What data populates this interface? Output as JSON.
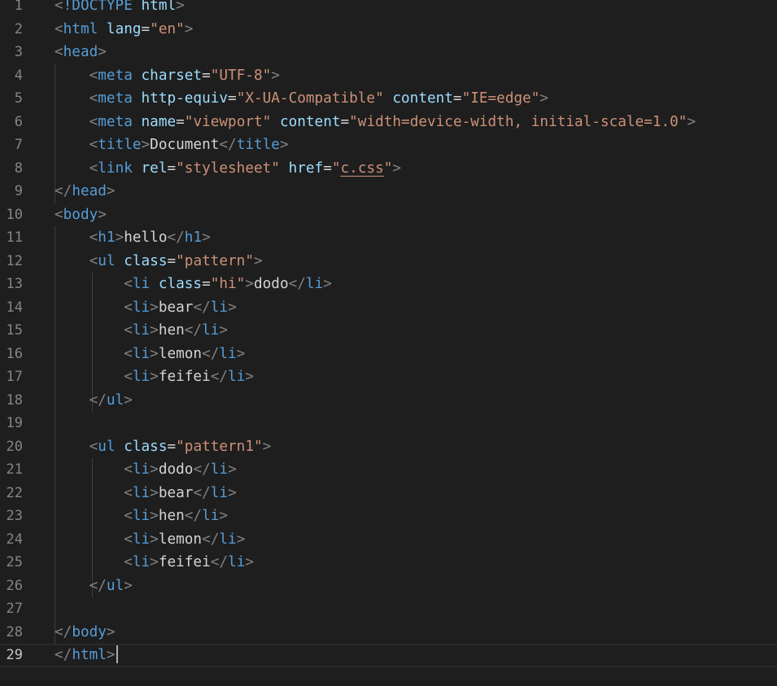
{
  "editor": {
    "active_line": 29,
    "lines": [
      {
        "n": "1",
        "tokens": [
          {
            "t": "<",
            "c": "p"
          },
          {
            "t": "!DOCTYPE",
            "c": "t"
          },
          {
            "t": " ",
            "c": "x"
          },
          {
            "t": "html",
            "c": "a"
          },
          {
            "t": ">",
            "c": "p"
          }
        ]
      },
      {
        "n": "2",
        "tokens": [
          {
            "t": "<",
            "c": "p"
          },
          {
            "t": "html",
            "c": "t"
          },
          {
            "t": " ",
            "c": "x"
          },
          {
            "t": "lang",
            "c": "a"
          },
          {
            "t": "=",
            "c": "x"
          },
          {
            "t": "\"en\"",
            "c": "s"
          },
          {
            "t": ">",
            "c": "p"
          }
        ]
      },
      {
        "n": "3",
        "tokens": [
          {
            "t": "<",
            "c": "p"
          },
          {
            "t": "head",
            "c": "t"
          },
          {
            "t": ">",
            "c": "p"
          }
        ]
      },
      {
        "n": "4",
        "tokens": [
          {
            "t": "    ",
            "c": "x"
          },
          {
            "t": "<",
            "c": "p"
          },
          {
            "t": "meta",
            "c": "t"
          },
          {
            "t": " ",
            "c": "x"
          },
          {
            "t": "charset",
            "c": "a"
          },
          {
            "t": "=",
            "c": "x"
          },
          {
            "t": "\"UTF-8\"",
            "c": "s"
          },
          {
            "t": ">",
            "c": "p"
          }
        ]
      },
      {
        "n": "5",
        "tokens": [
          {
            "t": "    ",
            "c": "x"
          },
          {
            "t": "<",
            "c": "p"
          },
          {
            "t": "meta",
            "c": "t"
          },
          {
            "t": " ",
            "c": "x"
          },
          {
            "t": "http-equiv",
            "c": "a"
          },
          {
            "t": "=",
            "c": "x"
          },
          {
            "t": "\"X-UA-Compatible\"",
            "c": "s"
          },
          {
            "t": " ",
            "c": "x"
          },
          {
            "t": "content",
            "c": "a"
          },
          {
            "t": "=",
            "c": "x"
          },
          {
            "t": "\"IE=edge\"",
            "c": "s"
          },
          {
            "t": ">",
            "c": "p"
          }
        ]
      },
      {
        "n": "6",
        "tokens": [
          {
            "t": "    ",
            "c": "x"
          },
          {
            "t": "<",
            "c": "p"
          },
          {
            "t": "meta",
            "c": "t"
          },
          {
            "t": " ",
            "c": "x"
          },
          {
            "t": "name",
            "c": "a"
          },
          {
            "t": "=",
            "c": "x"
          },
          {
            "t": "\"viewport\"",
            "c": "s"
          },
          {
            "t": " ",
            "c": "x"
          },
          {
            "t": "content",
            "c": "a"
          },
          {
            "t": "=",
            "c": "x"
          },
          {
            "t": "\"width=device-width, initial-scale=1.0\"",
            "c": "s"
          },
          {
            "t": ">",
            "c": "p"
          }
        ]
      },
      {
        "n": "7",
        "tokens": [
          {
            "t": "    ",
            "c": "x"
          },
          {
            "t": "<",
            "c": "p"
          },
          {
            "t": "title",
            "c": "t"
          },
          {
            "t": ">",
            "c": "p"
          },
          {
            "t": "Document",
            "c": "x"
          },
          {
            "t": "</",
            "c": "p"
          },
          {
            "t": "title",
            "c": "t"
          },
          {
            "t": ">",
            "c": "p"
          }
        ]
      },
      {
        "n": "8",
        "tokens": [
          {
            "t": "    ",
            "c": "x"
          },
          {
            "t": "<",
            "c": "p"
          },
          {
            "t": "link",
            "c": "t"
          },
          {
            "t": " ",
            "c": "x"
          },
          {
            "t": "rel",
            "c": "a"
          },
          {
            "t": "=",
            "c": "x"
          },
          {
            "t": "\"stylesheet\"",
            "c": "s"
          },
          {
            "t": " ",
            "c": "x"
          },
          {
            "t": "href",
            "c": "a"
          },
          {
            "t": "=",
            "c": "x"
          },
          {
            "t": "\"",
            "c": "s"
          },
          {
            "t": "c.css",
            "c": "s",
            "u": true
          },
          {
            "t": "\"",
            "c": "s"
          },
          {
            "t": ">",
            "c": "p"
          }
        ]
      },
      {
        "n": "9",
        "tokens": [
          {
            "t": "</",
            "c": "p"
          },
          {
            "t": "head",
            "c": "t"
          },
          {
            "t": ">",
            "c": "p"
          }
        ]
      },
      {
        "n": "10",
        "tokens": [
          {
            "t": "<",
            "c": "p"
          },
          {
            "t": "body",
            "c": "t"
          },
          {
            "t": ">",
            "c": "p"
          }
        ]
      },
      {
        "n": "11",
        "tokens": [
          {
            "t": "    ",
            "c": "x"
          },
          {
            "t": "<",
            "c": "p"
          },
          {
            "t": "h1",
            "c": "t"
          },
          {
            "t": ">",
            "c": "p"
          },
          {
            "t": "hello",
            "c": "x"
          },
          {
            "t": "</",
            "c": "p"
          },
          {
            "t": "h1",
            "c": "t"
          },
          {
            "t": ">",
            "c": "p"
          }
        ]
      },
      {
        "n": "12",
        "tokens": [
          {
            "t": "    ",
            "c": "x"
          },
          {
            "t": "<",
            "c": "p"
          },
          {
            "t": "ul",
            "c": "t"
          },
          {
            "t": " ",
            "c": "x"
          },
          {
            "t": "class",
            "c": "a"
          },
          {
            "t": "=",
            "c": "x"
          },
          {
            "t": "\"pattern\"",
            "c": "s"
          },
          {
            "t": ">",
            "c": "p"
          }
        ]
      },
      {
        "n": "13",
        "tokens": [
          {
            "t": "        ",
            "c": "x"
          },
          {
            "t": "<",
            "c": "p"
          },
          {
            "t": "li",
            "c": "t"
          },
          {
            "t": " ",
            "c": "x"
          },
          {
            "t": "class",
            "c": "a"
          },
          {
            "t": "=",
            "c": "x"
          },
          {
            "t": "\"hi\"",
            "c": "s"
          },
          {
            "t": ">",
            "c": "p"
          },
          {
            "t": "dodo",
            "c": "x"
          },
          {
            "t": "</",
            "c": "p"
          },
          {
            "t": "li",
            "c": "t"
          },
          {
            "t": ">",
            "c": "p"
          }
        ]
      },
      {
        "n": "14",
        "tokens": [
          {
            "t": "        ",
            "c": "x"
          },
          {
            "t": "<",
            "c": "p"
          },
          {
            "t": "li",
            "c": "t"
          },
          {
            "t": ">",
            "c": "p"
          },
          {
            "t": "bear",
            "c": "x"
          },
          {
            "t": "</",
            "c": "p"
          },
          {
            "t": "li",
            "c": "t"
          },
          {
            "t": ">",
            "c": "p"
          }
        ]
      },
      {
        "n": "15",
        "tokens": [
          {
            "t": "        ",
            "c": "x"
          },
          {
            "t": "<",
            "c": "p"
          },
          {
            "t": "li",
            "c": "t"
          },
          {
            "t": ">",
            "c": "p"
          },
          {
            "t": "hen",
            "c": "x"
          },
          {
            "t": "</",
            "c": "p"
          },
          {
            "t": "li",
            "c": "t"
          },
          {
            "t": ">",
            "c": "p"
          }
        ]
      },
      {
        "n": "16",
        "tokens": [
          {
            "t": "        ",
            "c": "x"
          },
          {
            "t": "<",
            "c": "p"
          },
          {
            "t": "li",
            "c": "t"
          },
          {
            "t": ">",
            "c": "p"
          },
          {
            "t": "lemon",
            "c": "x"
          },
          {
            "t": "</",
            "c": "p"
          },
          {
            "t": "li",
            "c": "t"
          },
          {
            "t": ">",
            "c": "p"
          }
        ]
      },
      {
        "n": "17",
        "tokens": [
          {
            "t": "        ",
            "c": "x"
          },
          {
            "t": "<",
            "c": "p"
          },
          {
            "t": "li",
            "c": "t"
          },
          {
            "t": ">",
            "c": "p"
          },
          {
            "t": "feifei",
            "c": "x"
          },
          {
            "t": "</",
            "c": "p"
          },
          {
            "t": "li",
            "c": "t"
          },
          {
            "t": ">",
            "c": "p"
          }
        ]
      },
      {
        "n": "18",
        "tokens": [
          {
            "t": "    ",
            "c": "x"
          },
          {
            "t": "</",
            "c": "p"
          },
          {
            "t": "ul",
            "c": "t"
          },
          {
            "t": ">",
            "c": "p"
          }
        ]
      },
      {
        "n": "19",
        "tokens": []
      },
      {
        "n": "20",
        "tokens": [
          {
            "t": "    ",
            "c": "x"
          },
          {
            "t": "<",
            "c": "p"
          },
          {
            "t": "ul",
            "c": "t"
          },
          {
            "t": " ",
            "c": "x"
          },
          {
            "t": "class",
            "c": "a"
          },
          {
            "t": "=",
            "c": "x"
          },
          {
            "t": "\"pattern1\"",
            "c": "s"
          },
          {
            "t": ">",
            "c": "p"
          }
        ]
      },
      {
        "n": "21",
        "tokens": [
          {
            "t": "        ",
            "c": "x"
          },
          {
            "t": "<",
            "c": "p"
          },
          {
            "t": "li",
            "c": "t"
          },
          {
            "t": ">",
            "c": "p"
          },
          {
            "t": "dodo",
            "c": "x"
          },
          {
            "t": "</",
            "c": "p"
          },
          {
            "t": "li",
            "c": "t"
          },
          {
            "t": ">",
            "c": "p"
          }
        ]
      },
      {
        "n": "22",
        "tokens": [
          {
            "t": "        ",
            "c": "x"
          },
          {
            "t": "<",
            "c": "p"
          },
          {
            "t": "li",
            "c": "t"
          },
          {
            "t": ">",
            "c": "p"
          },
          {
            "t": "bear",
            "c": "x"
          },
          {
            "t": "</",
            "c": "p"
          },
          {
            "t": "li",
            "c": "t"
          },
          {
            "t": ">",
            "c": "p"
          }
        ]
      },
      {
        "n": "23",
        "tokens": [
          {
            "t": "        ",
            "c": "x"
          },
          {
            "t": "<",
            "c": "p"
          },
          {
            "t": "li",
            "c": "t"
          },
          {
            "t": ">",
            "c": "p"
          },
          {
            "t": "hen",
            "c": "x"
          },
          {
            "t": "</",
            "c": "p"
          },
          {
            "t": "li",
            "c": "t"
          },
          {
            "t": ">",
            "c": "p"
          }
        ]
      },
      {
        "n": "24",
        "tokens": [
          {
            "t": "        ",
            "c": "x"
          },
          {
            "t": "<",
            "c": "p"
          },
          {
            "t": "li",
            "c": "t"
          },
          {
            "t": ">",
            "c": "p"
          },
          {
            "t": "lemon",
            "c": "x"
          },
          {
            "t": "</",
            "c": "p"
          },
          {
            "t": "li",
            "c": "t"
          },
          {
            "t": ">",
            "c": "p"
          }
        ]
      },
      {
        "n": "25",
        "tokens": [
          {
            "t": "        ",
            "c": "x"
          },
          {
            "t": "<",
            "c": "p"
          },
          {
            "t": "li",
            "c": "t"
          },
          {
            "t": ">",
            "c": "p"
          },
          {
            "t": "feifei",
            "c": "x"
          },
          {
            "t": "</",
            "c": "p"
          },
          {
            "t": "li",
            "c": "t"
          },
          {
            "t": ">",
            "c": "p"
          }
        ]
      },
      {
        "n": "26",
        "tokens": [
          {
            "t": "    ",
            "c": "x"
          },
          {
            "t": "</",
            "c": "p"
          },
          {
            "t": "ul",
            "c": "t"
          },
          {
            "t": ">",
            "c": "p"
          }
        ]
      },
      {
        "n": "27",
        "tokens": []
      },
      {
        "n": "28",
        "tokens": [
          {
            "t": "</",
            "c": "p"
          },
          {
            "t": "body",
            "c": "t"
          },
          {
            "t": ">",
            "c": "p"
          }
        ]
      },
      {
        "n": "29",
        "tokens": [
          {
            "t": "</",
            "c": "p"
          },
          {
            "t": "html",
            "c": "t"
          },
          {
            "t": ">",
            "c": "p"
          }
        ]
      }
    ]
  },
  "colors": {
    "background": "#1e1e1e",
    "line_number": "#858585",
    "punctuation": "#808080",
    "tag": "#569cd6",
    "attribute": "#9cdcfe",
    "string": "#ce9178",
    "text": "#d4d4d4"
  }
}
